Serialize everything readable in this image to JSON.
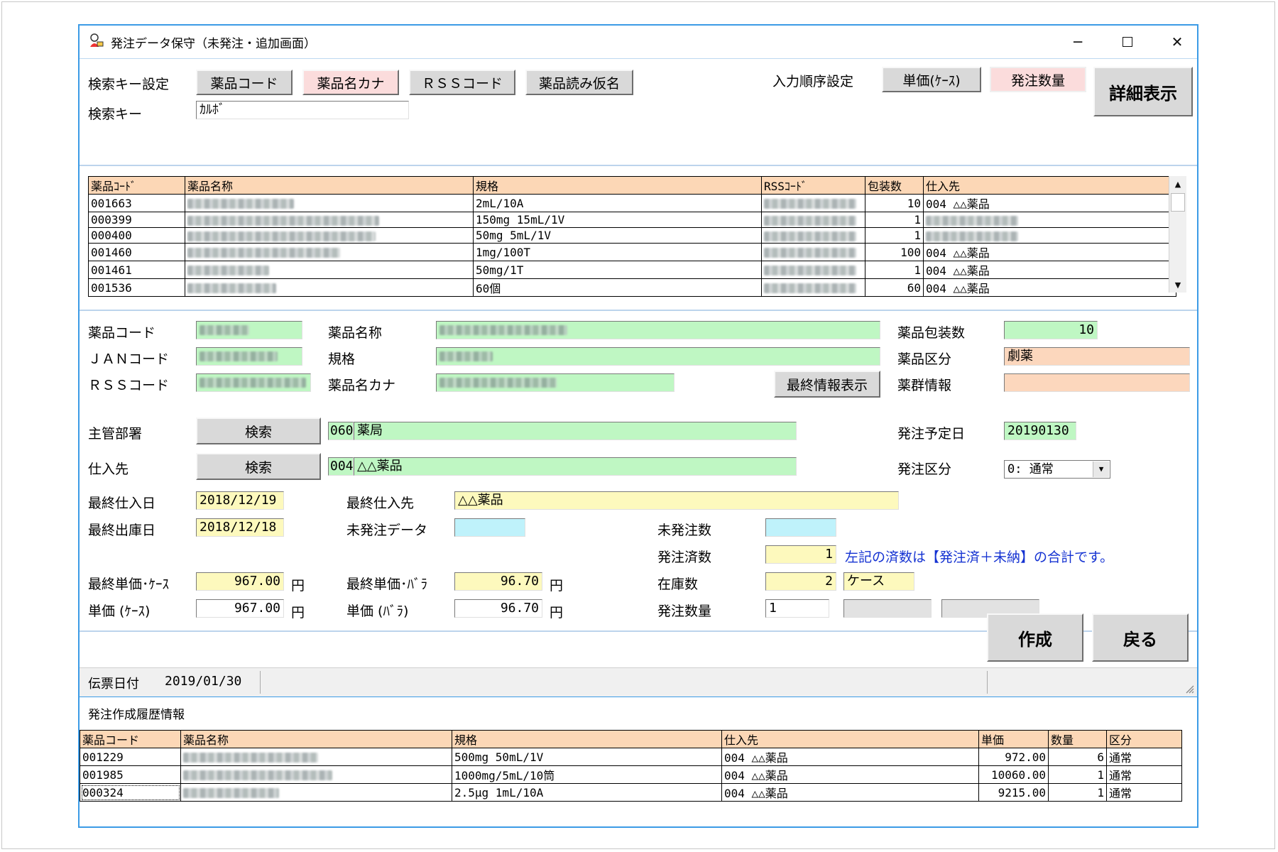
{
  "window": {
    "title": "発注データ保守（未発注・追加画面）"
  },
  "search": {
    "key_setting_label": "検索キー設定",
    "buttons": [
      "薬品コード",
      "薬品名カナ",
      "ＲＳＳコード",
      "薬品読み仮名"
    ],
    "key_label": "検索キー",
    "key_value": "ｶﾙﾎﾞ"
  },
  "input_order": {
    "label": "入力順序設定",
    "unit_price_button": "単価(ｹｰｽ)",
    "quantity_button": "発注数量",
    "detail_button": "詳細表示"
  },
  "top_table": {
    "headers": [
      "薬品ｺｰﾄﾞ",
      "薬品名称",
      "規格",
      "RSSｺｰﾄﾞ",
      "包装数",
      "仕入先"
    ],
    "rows": [
      {
        "code": "001663",
        "spec": "2mL/10A",
        "qty": "10",
        "supplier": "004 △△薬品"
      },
      {
        "code": "000399",
        "spec": "150mg 15mL/1V",
        "qty": "1",
        "supplier": ""
      },
      {
        "code": "000400",
        "spec": "50mg 5mL/1V",
        "qty": "1",
        "supplier": ""
      },
      {
        "code": "001460",
        "spec": "1mg/100T",
        "qty": "100",
        "supplier": "004 △△薬品"
      },
      {
        "code": "001461",
        "spec": "50mg/1T",
        "qty": "1",
        "supplier": "004 △△薬品"
      },
      {
        "code": "001536",
        "spec": "60個",
        "qty": "60",
        "supplier": "004 △△薬品"
      }
    ]
  },
  "detail": {
    "drug_code_label": "薬品コード",
    "jan_label": "ＪＡＮコード",
    "rss_label": "ＲＳＳコード",
    "drug_name_label": "薬品名称",
    "spec_label": "規格",
    "kana_label": "薬品名カナ",
    "last_info_button": "最終情報表示",
    "pack_label": "薬品包装数",
    "pack_value": "10",
    "category_label": "薬品区分",
    "category_value": "劇薬",
    "group_label": "薬群情報",
    "group_value": "",
    "dept_label": "主管部署",
    "search_button": "検索",
    "dept_code": "060",
    "dept_name": "薬局",
    "supplier_label": "仕入先",
    "supplier_code": "004",
    "supplier_name": "△△薬品",
    "order_date_label": "発注予定日",
    "order_date_value": "20190130",
    "order_type_label": "発注区分",
    "order_type_value": "0: 通常",
    "last_purchase_date_label": "最終仕入日",
    "last_purchase_date_value": "2018/12/19",
    "last_supplier_label": "最終仕入先",
    "last_supplier_value": "△△薬品",
    "last_issue_date_label": "最終出庫日",
    "last_issue_date_value": "2018/12/18",
    "unordered_data_label": "未発注データ",
    "unordered_data_value": "",
    "unordered_count_label": "未発注数",
    "unordered_count_value": "",
    "ordered_count_label": "発注済数",
    "ordered_count_value": "1",
    "ordered_note": "左記の済数は【発注済＋未納】の合計です。",
    "last_price_case_label": "最終単価･ｹｰｽ",
    "last_price_case_value": "967.00",
    "last_price_bara_label": "最終単価･ﾊﾞﾗ",
    "last_price_bara_value": "96.70",
    "stock_label": "在庫数",
    "stock_value": "2",
    "stock_unit": "ケース",
    "price_case_label": "単価 (ｹｰｽ)",
    "price_case_value": "967.00",
    "price_bara_label": "単価 (ﾊﾞﾗ)",
    "price_bara_value": "96.70",
    "order_qty_label": "発注数量",
    "order_qty_value": "1",
    "yen": "円"
  },
  "actions": {
    "create_button": "作成",
    "back_button": "戻る"
  },
  "status_bar": {
    "slip_date_label": "伝票日付",
    "slip_date_value": "2019/01/30"
  },
  "history": {
    "title": "発注作成履歴情報",
    "headers": [
      "薬品コード",
      "薬品名称",
      "規格",
      "仕入先",
      "単価",
      "数量",
      "区分"
    ],
    "rows": [
      {
        "code": "001229",
        "spec": "500mg 50mL/1V",
        "supplier": "004 △△薬品",
        "price": "972.00",
        "qty": "6",
        "type": "通常"
      },
      {
        "code": "001985",
        "spec": "1000mg/5mL/10筒",
        "supplier": "004 △△薬品",
        "price": "10060.00",
        "qty": "1",
        "type": "通常"
      },
      {
        "code": "000324",
        "spec": "2.5μg 1mL/10A",
        "supplier": "004 △△薬品",
        "price": "9215.00",
        "qty": "1",
        "type": "通常"
      }
    ]
  }
}
